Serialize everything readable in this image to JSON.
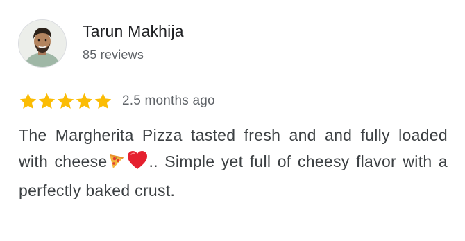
{
  "reviewer": {
    "name": "Tarun Makhija",
    "review_count": "85 reviews",
    "avatar_icon": "profile-photo"
  },
  "rating": {
    "stars": 5,
    "max_stars": 5,
    "star_color": "#fbbc04",
    "date": "2.5 months ago"
  },
  "review": {
    "text_part1": "The Margherita Pizza tasted fresh and and fully loaded with cheese",
    "emoji1": "pizza-emoji",
    "emoji2": "red-heart-emoji",
    "text_part2": ".. Simple yet full of cheesy flavor with a perfectly baked crust."
  }
}
